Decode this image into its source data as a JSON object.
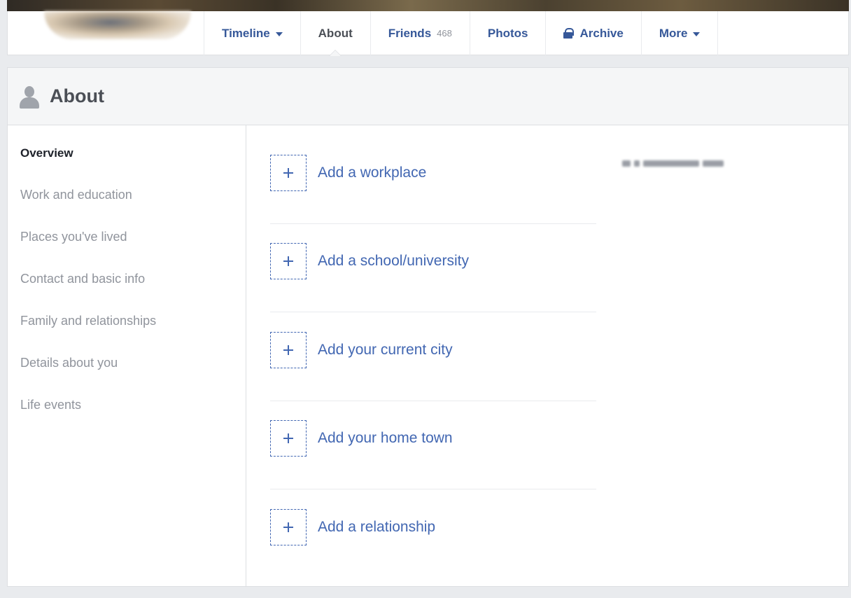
{
  "nav": {
    "tabs": [
      {
        "label": "Timeline",
        "has_caret": true
      },
      {
        "label": "About",
        "active": true
      },
      {
        "label": "Friends",
        "count": "468"
      },
      {
        "label": "Photos"
      },
      {
        "label": "Archive",
        "icon": "lock-icon"
      },
      {
        "label": "More",
        "has_caret": true
      }
    ]
  },
  "about": {
    "title": "About",
    "icon": "person-icon",
    "menu": [
      {
        "label": "Overview",
        "selected": true
      },
      {
        "label": "Work and education"
      },
      {
        "label": "Places you've lived"
      },
      {
        "label": "Contact and basic info"
      },
      {
        "label": "Family and relationships"
      },
      {
        "label": "Details about you"
      },
      {
        "label": "Life events"
      }
    ],
    "add_items": [
      {
        "label": "Add a workplace"
      },
      {
        "label": "Add a school/university"
      },
      {
        "label": "Add your current city"
      },
      {
        "label": "Add your home town"
      },
      {
        "label": "Add a relationship"
      }
    ]
  },
  "colors": {
    "link": "#4267b2",
    "nav_text": "#365899",
    "page_bg": "#e9ebee",
    "muted": "#90949c"
  }
}
